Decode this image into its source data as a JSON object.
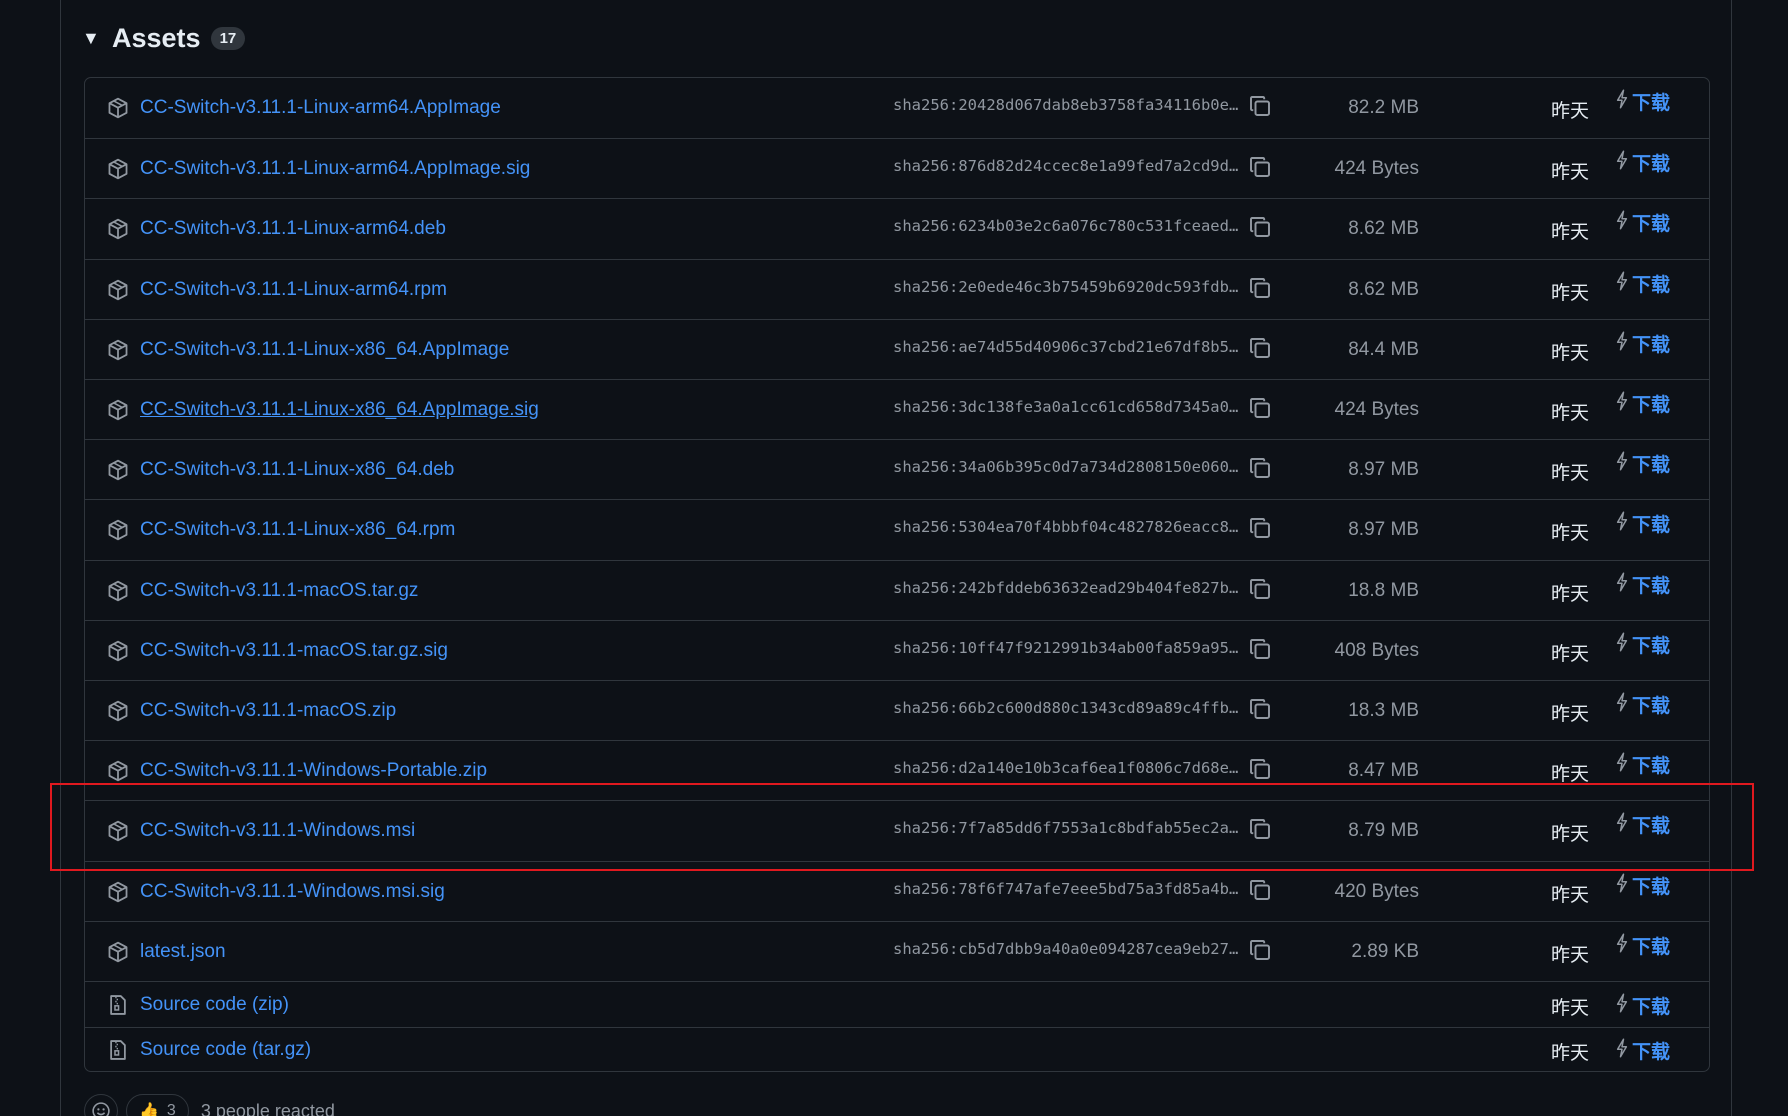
{
  "assets": {
    "title": "Assets",
    "count": "17",
    "rows": [
      {
        "name": "CC-Switch-v3.11.1-Linux-arm64.AppImage",
        "sha": "sha256:20428d067dab8eb3758fa34116b0e…",
        "size": "82.2 MB",
        "date": "昨天",
        "download": "下载"
      },
      {
        "name": "CC-Switch-v3.11.1-Linux-arm64.AppImage.sig",
        "sha": "sha256:876d82d24ccec8e1a99fed7a2cd9d…",
        "size": "424 Bytes",
        "date": "昨天",
        "download": "下载"
      },
      {
        "name": "CC-Switch-v3.11.1-Linux-arm64.deb",
        "sha": "sha256:6234b03e2c6a076c780c531fceaed…",
        "size": "8.62 MB",
        "date": "昨天",
        "download": "下载"
      },
      {
        "name": "CC-Switch-v3.11.1-Linux-arm64.rpm",
        "sha": "sha256:2e0ede46c3b75459b6920dc593fdb…",
        "size": "8.62 MB",
        "date": "昨天",
        "download": "下载"
      },
      {
        "name": "CC-Switch-v3.11.1-Linux-x86_64.AppImage",
        "sha": "sha256:ae74d55d40906c37cbd21e67df8b5…",
        "size": "84.4 MB",
        "date": "昨天",
        "download": "下载"
      },
      {
        "name": "CC-Switch-v3.11.1-Linux-x86_64.AppImage.sig",
        "sha": "sha256:3dc138fe3a0a1cc61cd658d7345a0…",
        "size": "424 Bytes",
        "date": "昨天",
        "download": "下载"
      },
      {
        "name": "CC-Switch-v3.11.1-Linux-x86_64.deb",
        "sha": "sha256:34a06b395c0d7a734d2808150e060…",
        "size": "8.97 MB",
        "date": "昨天",
        "download": "下载"
      },
      {
        "name": "CC-Switch-v3.11.1-Linux-x86_64.rpm",
        "sha": "sha256:5304ea70f4bbbf04c4827826eacc8…",
        "size": "8.97 MB",
        "date": "昨天",
        "download": "下载"
      },
      {
        "name": "CC-Switch-v3.11.1-macOS.tar.gz",
        "sha": "sha256:242bfddeb63632ead29b404fe827b…",
        "size": "18.8 MB",
        "date": "昨天",
        "download": "下载"
      },
      {
        "name": "CC-Switch-v3.11.1-macOS.tar.gz.sig",
        "sha": "sha256:10ff47f9212991b34ab00fa859a95…",
        "size": "408 Bytes",
        "date": "昨天",
        "download": "下载"
      },
      {
        "name": "CC-Switch-v3.11.1-macOS.zip",
        "sha": "sha256:66b2c600d880c1343cd89a89c4ffb…",
        "size": "18.3 MB",
        "date": "昨天",
        "download": "下载"
      },
      {
        "name": "CC-Switch-v3.11.1-Windows-Portable.zip",
        "sha": "sha256:d2a140e10b3caf6ea1f0806c7d68e…",
        "size": "8.47 MB",
        "date": "昨天",
        "download": "下载"
      },
      {
        "name": "CC-Switch-v3.11.1-Windows.msi",
        "sha": "sha256:7f7a85dd6f7553a1c8bdfab55ec2a…",
        "size": "8.79 MB",
        "date": "昨天",
        "download": "下载"
      },
      {
        "name": "CC-Switch-v3.11.1-Windows.msi.sig",
        "sha": "sha256:78f6f747afe7eee5bd75a3fd85a4b…",
        "size": "420 Bytes",
        "date": "昨天",
        "download": "下载"
      },
      {
        "name": "latest.json",
        "sha": "sha256:cb5d7dbb9a40a0e094287cea9eb27…",
        "size": "2.89 KB",
        "date": "昨天",
        "download": "下载"
      }
    ],
    "source": [
      {
        "name": "Source code",
        "suffix": "(zip)",
        "date": "昨天",
        "download": "下载"
      },
      {
        "name": "Source code",
        "suffix": "(tar.gz)",
        "date": "昨天",
        "download": "下载"
      }
    ]
  },
  "reactions": {
    "thumbs_count": "3",
    "text": "3 people reacted"
  },
  "colors": {
    "background": "#0d1117",
    "link": "#4493f8",
    "muted": "#9198a1",
    "border": "#30363d",
    "highlight": "#e0191f"
  },
  "icons": [
    "triangle-down-icon",
    "package-icon",
    "file-zip-icon",
    "copy-icon",
    "zap-icon",
    "smiley-icon"
  ]
}
